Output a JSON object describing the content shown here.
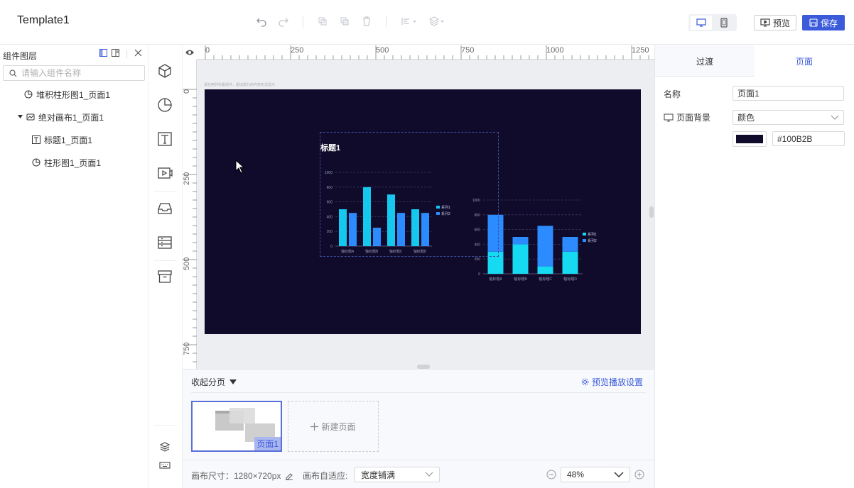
{
  "app": {
    "title": "Template1",
    "preview_label": "预览",
    "save_label": "保存"
  },
  "layers": {
    "heading": "组件图层",
    "search_placeholder": "请输入组件名称",
    "items": [
      {
        "label": "堆积柱形图1_页面1",
        "icon": "pie-chart-icon"
      },
      {
        "label": "绝对画布1_页面1",
        "icon": "canvas-icon"
      },
      {
        "label": "标题1_页面1",
        "icon": "text-icon"
      },
      {
        "label": "柱形图1_页面1",
        "icon": "pie-chart-icon"
      }
    ]
  },
  "components": [
    "cube-icon",
    "pie-chart-icon",
    "text-icon",
    "video-icon",
    "inbox-icon",
    "form-icon",
    "archive-icon",
    "layers-icon",
    "keyboard-icon"
  ],
  "ruler": {
    "top_labels": [
      "0",
      "250",
      "500",
      "750",
      "1000",
      "1250"
    ],
    "left_labels": [
      "0",
      "250",
      "500",
      "750"
    ]
  },
  "canvas": {
    "hint": "请在两列布置组件，超出部分的内容无法显示",
    "background": "#100B2B",
    "title_text": "标题1"
  },
  "chart_data": [
    {
      "type": "bar",
      "categories": [
        "轴标题A",
        "轴标题B",
        "轴标题C",
        "轴标题D"
      ],
      "series": [
        {
          "name": "系列1",
          "values": [
            500,
            800,
            700,
            500
          ],
          "color": "#16c8ee"
        },
        {
          "name": "系列2",
          "values": [
            450,
            250,
            450,
            450
          ],
          "color": "#2b8bff"
        }
      ],
      "ylim": [
        0,
        1000
      ],
      "yticks": [
        "0",
        "200",
        "400",
        "600",
        "800",
        "1000"
      ],
      "grid": true,
      "legend": "right"
    },
    {
      "type": "bar",
      "stacked": true,
      "categories": [
        "轴标题A",
        "轴标题B",
        "轴标题C",
        "轴标题D"
      ],
      "series": [
        {
          "name": "系列1",
          "values": [
            300,
            400,
            100,
            300
          ],
          "color": "#16d9f2"
        },
        {
          "name": "系列2",
          "values": [
            500,
            100,
            550,
            200
          ],
          "color": "#2b8bff"
        }
      ],
      "ylim": [
        0,
        1000
      ],
      "yticks": [
        "0",
        "200",
        "400",
        "600",
        "800",
        "1000"
      ],
      "grid": true,
      "legend": "right"
    }
  ],
  "pages": {
    "collapse_label": "收起分页",
    "settings_label": "预览播放设置",
    "items": [
      {
        "label": "页面1"
      }
    ],
    "new_page_label": "新建页面"
  },
  "statusbar": {
    "canvas_size_label": "画布尺寸：1280×720px",
    "fit_label": "画布自适应:",
    "fit_value": "宽度铺满",
    "zoom_value": "48%"
  },
  "props": {
    "tabs": [
      "过渡",
      "页面"
    ],
    "active_tab": "页面",
    "name_label": "名称",
    "name_value": "页面1",
    "bg_label": "页面背景",
    "bg_type": "颜色",
    "bg_color": "#100B2B"
  }
}
